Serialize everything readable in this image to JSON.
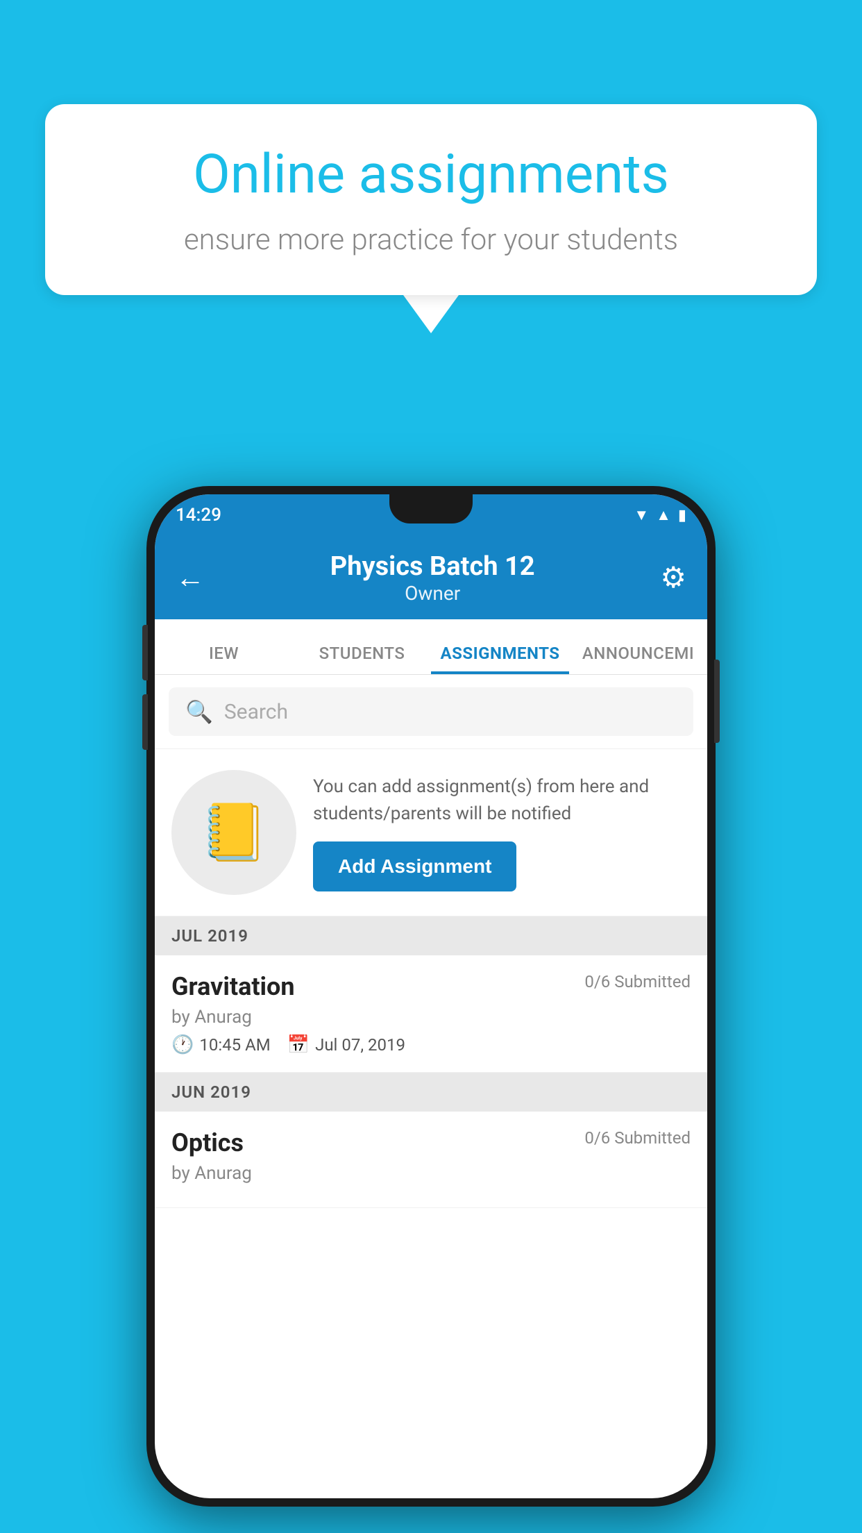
{
  "background_color": "#1BBDE8",
  "speech_bubble": {
    "title": "Online assignments",
    "subtitle": "ensure more practice for your students"
  },
  "phone": {
    "status_bar": {
      "time": "14:29",
      "icons": [
        "wifi",
        "signal",
        "battery"
      ]
    },
    "header": {
      "title": "Physics Batch 12",
      "subtitle": "Owner",
      "back_label": "←",
      "gear_label": "⚙"
    },
    "tabs": [
      {
        "label": "IEW",
        "active": false
      },
      {
        "label": "STUDENTS",
        "active": false
      },
      {
        "label": "ASSIGNMENTS",
        "active": true
      },
      {
        "label": "ANNOUNCEMI",
        "active": false
      }
    ],
    "search": {
      "placeholder": "Search"
    },
    "promo": {
      "text": "You can add assignment(s) from here and students/parents will be notified",
      "button_label": "Add Assignment"
    },
    "sections": [
      {
        "month": "JUL 2019",
        "assignments": [
          {
            "name": "Gravitation",
            "status": "0/6 Submitted",
            "by": "by Anurag",
            "time": "10:45 AM",
            "date": "Jul 07, 2019"
          }
        ]
      },
      {
        "month": "JUN 2019",
        "assignments": [
          {
            "name": "Optics",
            "status": "0/6 Submitted",
            "by": "by Anurag",
            "time": "",
            "date": ""
          }
        ]
      }
    ]
  }
}
